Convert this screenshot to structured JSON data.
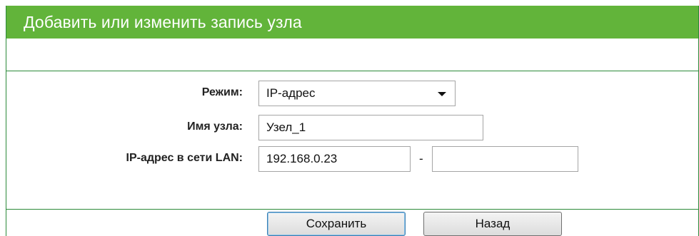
{
  "header": {
    "title": "Добавить или изменить запись узла"
  },
  "form": {
    "mode": {
      "label": "Режим:",
      "value": "IP-адрес"
    },
    "host_name": {
      "label": "Имя узла:",
      "value": "Узел_1"
    },
    "lan_ip": {
      "label": "IP-адрес в сети LAN:",
      "start_value": "192.168.0.23",
      "separator": "-",
      "end_value": ""
    }
  },
  "buttons": {
    "save_label": "Сохранить",
    "back_label": "Назад"
  },
  "colors": {
    "title_bar": "#62b43a",
    "border": "#2c8a3a"
  }
}
